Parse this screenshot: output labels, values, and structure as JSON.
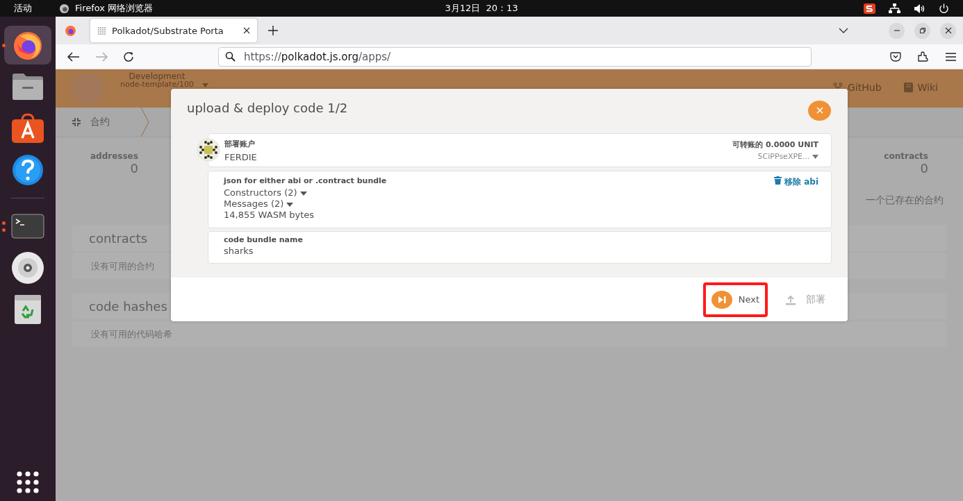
{
  "top_bar": {
    "activities": "活动",
    "app_name": "Firefox 网络浏览器",
    "clock": "3月12日  20：13"
  },
  "dock": {
    "items": [
      {
        "kind": "firefox",
        "running": true,
        "multiple": false,
        "selected": true
      },
      {
        "kind": "files",
        "running": false,
        "multiple": false,
        "selected": false
      },
      {
        "kind": "store",
        "running": false,
        "multiple": false,
        "selected": false
      },
      {
        "kind": "help",
        "running": false,
        "multiple": false,
        "selected": false
      },
      {
        "kind": "terminal",
        "running": true,
        "multiple": true,
        "selected": false
      },
      {
        "kind": "disc",
        "running": false,
        "multiple": false,
        "selected": false
      },
      {
        "kind": "trash",
        "running": false,
        "multiple": false,
        "selected": false
      }
    ]
  },
  "browser": {
    "tabs": [
      {
        "title": "Polkadot/Substrate Porta",
        "selected": true
      }
    ],
    "url": {
      "scheme": "https://",
      "host": "polkadot.js.org",
      "path": "/apps/"
    }
  },
  "page": {
    "network": {
      "chain": "Development",
      "node": "node-template/100"
    },
    "links": [
      {
        "label": "GitHub",
        "kind": "github"
      },
      {
        "label": "Wiki",
        "kind": "wiki"
      }
    ],
    "subnav": {
      "label": "合约"
    },
    "stats": [
      {
        "label": "addresses",
        "value": "0"
      },
      {
        "label": "contracts",
        "value": "0"
      }
    ],
    "hint": "一个已存在的合约",
    "sections": [
      {
        "title": "contracts",
        "empty": "没有可用的合约"
      },
      {
        "title": "code hashes",
        "empty": "没有可用的代码哈希"
      }
    ]
  },
  "modal": {
    "title": "upload & deploy code 1/2",
    "account": {
      "label": "部署账户",
      "name": "FERDIE",
      "balance": "可转账的 **0.**0000 UNIT",
      "address": "5CiPPseXPE..."
    },
    "abi": {
      "label": "json for either abi or .contract bundle",
      "constructors": "Constructors (2)",
      "messages": "Messages (2)",
      "size": "14,855 WASM bytes",
      "remove": "移除 abi"
    },
    "bundle_name": {
      "label": "code bundle name",
      "value": "sharks"
    },
    "buttons": [
      {
        "label": "Next",
        "kind": "next",
        "disabled": false,
        "highlighted": true
      },
      {
        "label": "部署",
        "kind": "deploy",
        "disabled": true,
        "highlighted": false
      }
    ]
  }
}
